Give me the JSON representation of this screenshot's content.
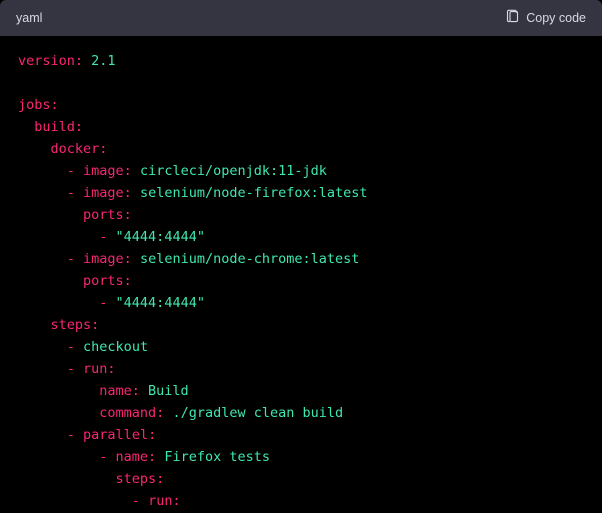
{
  "header": {
    "language": "yaml",
    "copy_label": "Copy code"
  },
  "code": {
    "version_key": "version:",
    "version_val": " 2.1",
    "jobs_key": "jobs:",
    "build_key": "build:",
    "docker_key": "docker:",
    "image_key": "image:",
    "image1_val": " circleci/openjdk:11-jdk",
    "image2_val": " selenium/node-firefox:latest",
    "image3_val": " selenium/node-chrome:latest",
    "ports_key": "ports:",
    "port_val": "\"4444:4444\"",
    "steps_key": "steps:",
    "checkout": "checkout",
    "run_key": "run:",
    "name_key": "name:",
    "name_build_val": " Build",
    "command_key": "command:",
    "command_val": " ./gradlew clean build",
    "parallel_key": "parallel:",
    "name_firefox_val": " Firefox tests",
    "dash": "- "
  }
}
